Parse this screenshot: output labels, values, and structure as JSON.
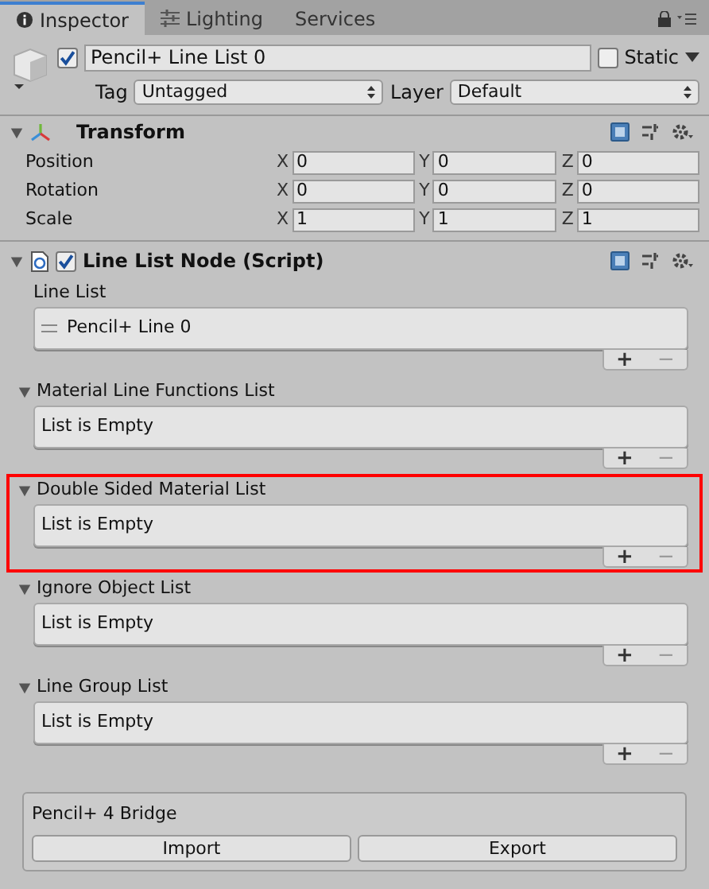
{
  "tabs": [
    {
      "label": "Inspector",
      "selected": true
    },
    {
      "label": "Lighting",
      "selected": false
    },
    {
      "label": "Services",
      "selected": false
    }
  ],
  "object": {
    "active": true,
    "name": "Pencil+ Line List 0",
    "static_label": "Static",
    "static": false,
    "tag_label": "Tag",
    "tag": "Untagged",
    "layer_label": "Layer",
    "layer": "Default"
  },
  "transform": {
    "title": "Transform",
    "expanded": true,
    "rows": [
      {
        "label": "Position",
        "axes": [
          {
            "axis": "X",
            "value": "0"
          },
          {
            "axis": "Y",
            "value": "0"
          },
          {
            "axis": "Z",
            "value": "0"
          }
        ]
      },
      {
        "label": "Rotation",
        "axes": [
          {
            "axis": "X",
            "value": "0"
          },
          {
            "axis": "Y",
            "value": "0"
          },
          {
            "axis": "Z",
            "value": "0"
          }
        ]
      },
      {
        "label": "Scale",
        "axes": [
          {
            "axis": "X",
            "value": "1"
          },
          {
            "axis": "Y",
            "value": "1"
          },
          {
            "axis": "Z",
            "value": "1"
          }
        ]
      }
    ]
  },
  "script": {
    "title": "Line List Node (Script)",
    "expanded": true,
    "enabled": true,
    "lists": [
      {
        "kind": "plain",
        "label": "Line List",
        "highlighted": false,
        "items": [
          "Pencil+ Line 0"
        ],
        "add": "+",
        "remove": "−"
      },
      {
        "kind": "foldout",
        "expanded": true,
        "label": "Material Line Functions List",
        "highlighted": false,
        "empty_text": "List is Empty",
        "add": "+",
        "remove": "−"
      },
      {
        "kind": "foldout",
        "expanded": true,
        "label": "Double Sided Material List",
        "highlighted": true,
        "empty_text": "List is Empty",
        "add": "+",
        "remove": "−"
      },
      {
        "kind": "foldout",
        "expanded": true,
        "label": "Ignore Object List",
        "highlighted": false,
        "empty_text": "List is Empty",
        "add": "+",
        "remove": "−"
      },
      {
        "kind": "foldout",
        "expanded": true,
        "label": "Line Group List",
        "highlighted": false,
        "empty_text": "List is Empty",
        "add": "+",
        "remove": "−"
      }
    ]
  },
  "bridge": {
    "title": "Pencil+ 4 Bridge",
    "buttons": [
      "Import",
      "Export"
    ]
  }
}
